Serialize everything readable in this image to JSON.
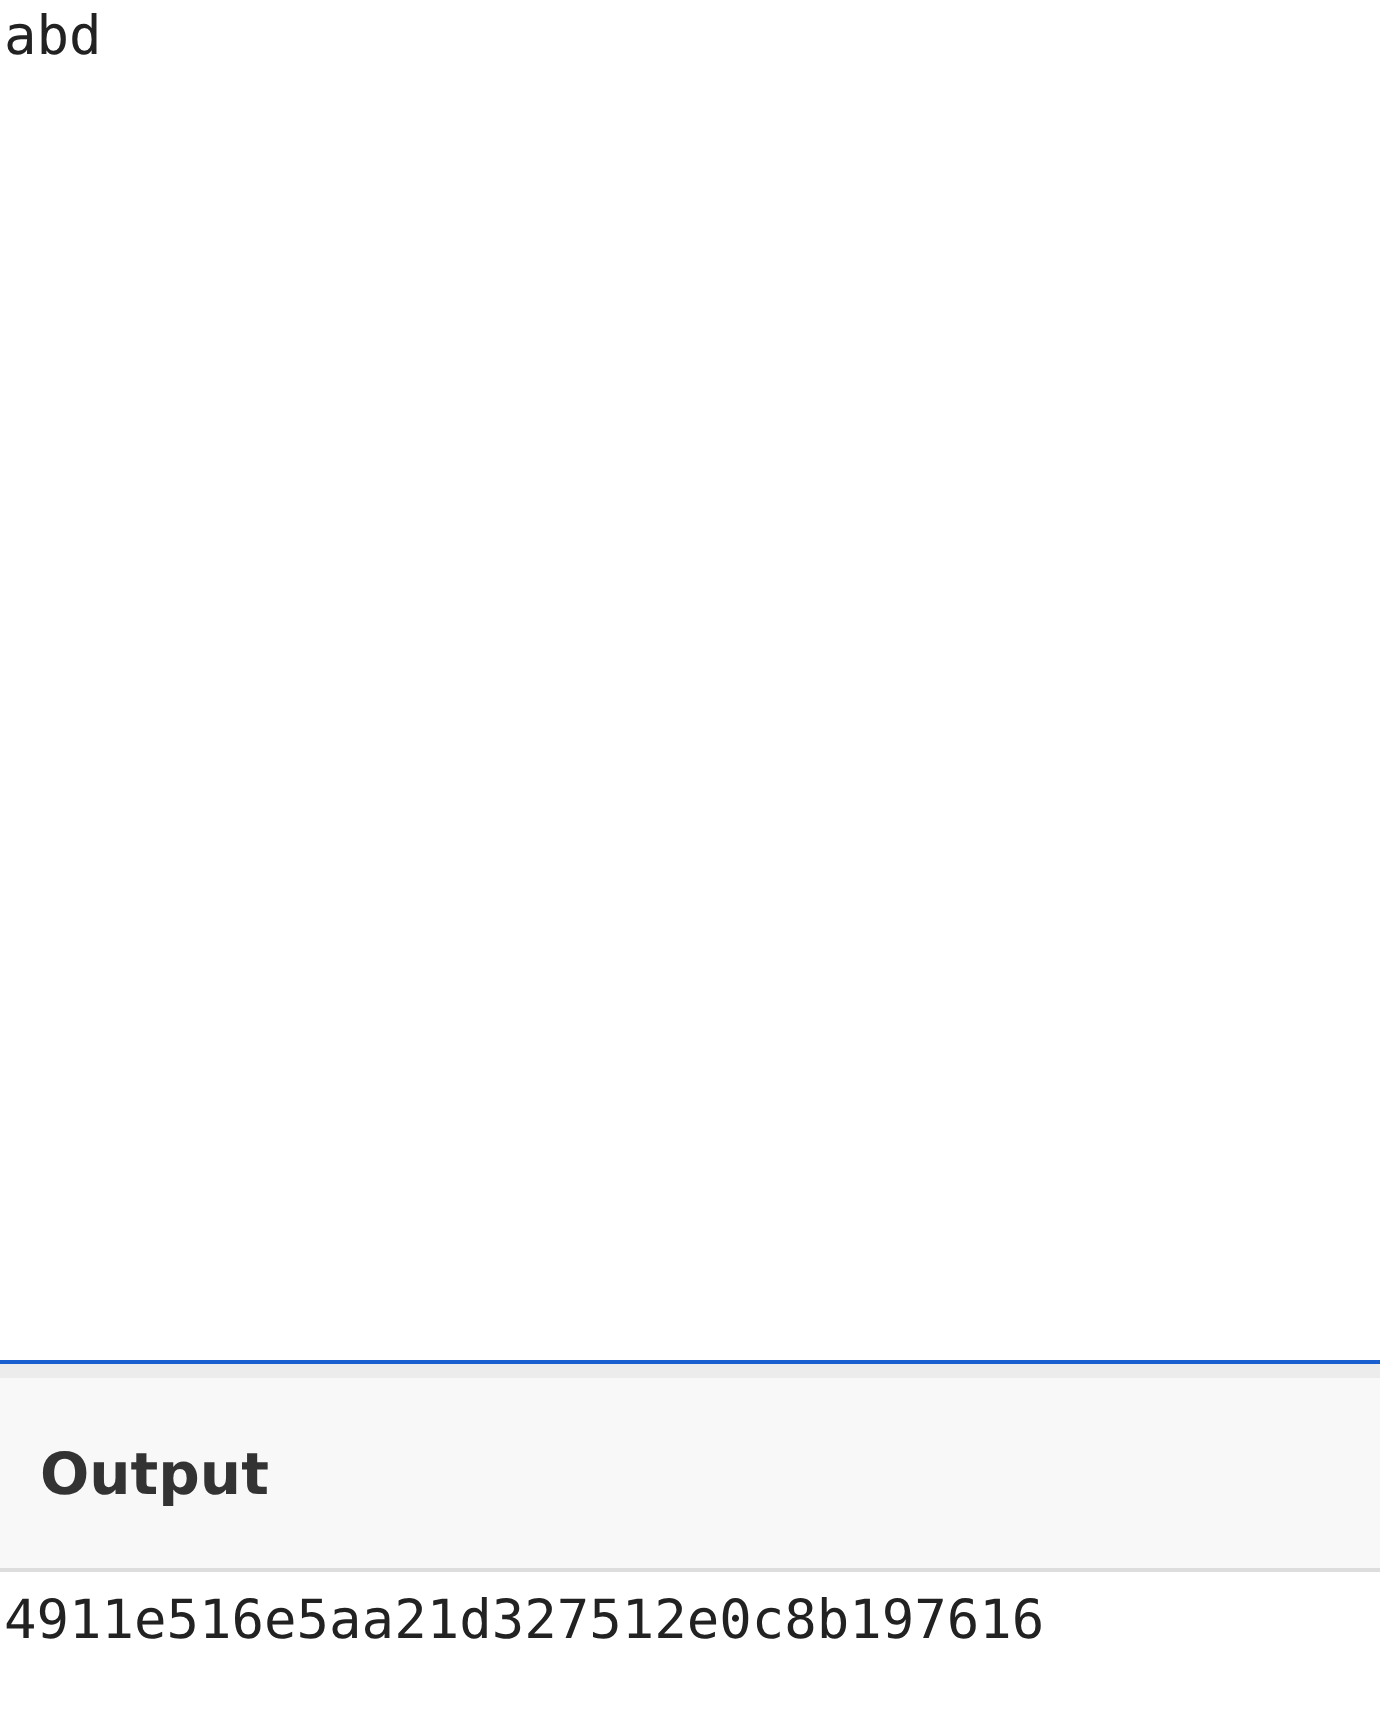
{
  "editor": {
    "value": "abd"
  },
  "output": {
    "title": "Output",
    "text": "4911e516e5aa21d327512e0c8b197616"
  }
}
